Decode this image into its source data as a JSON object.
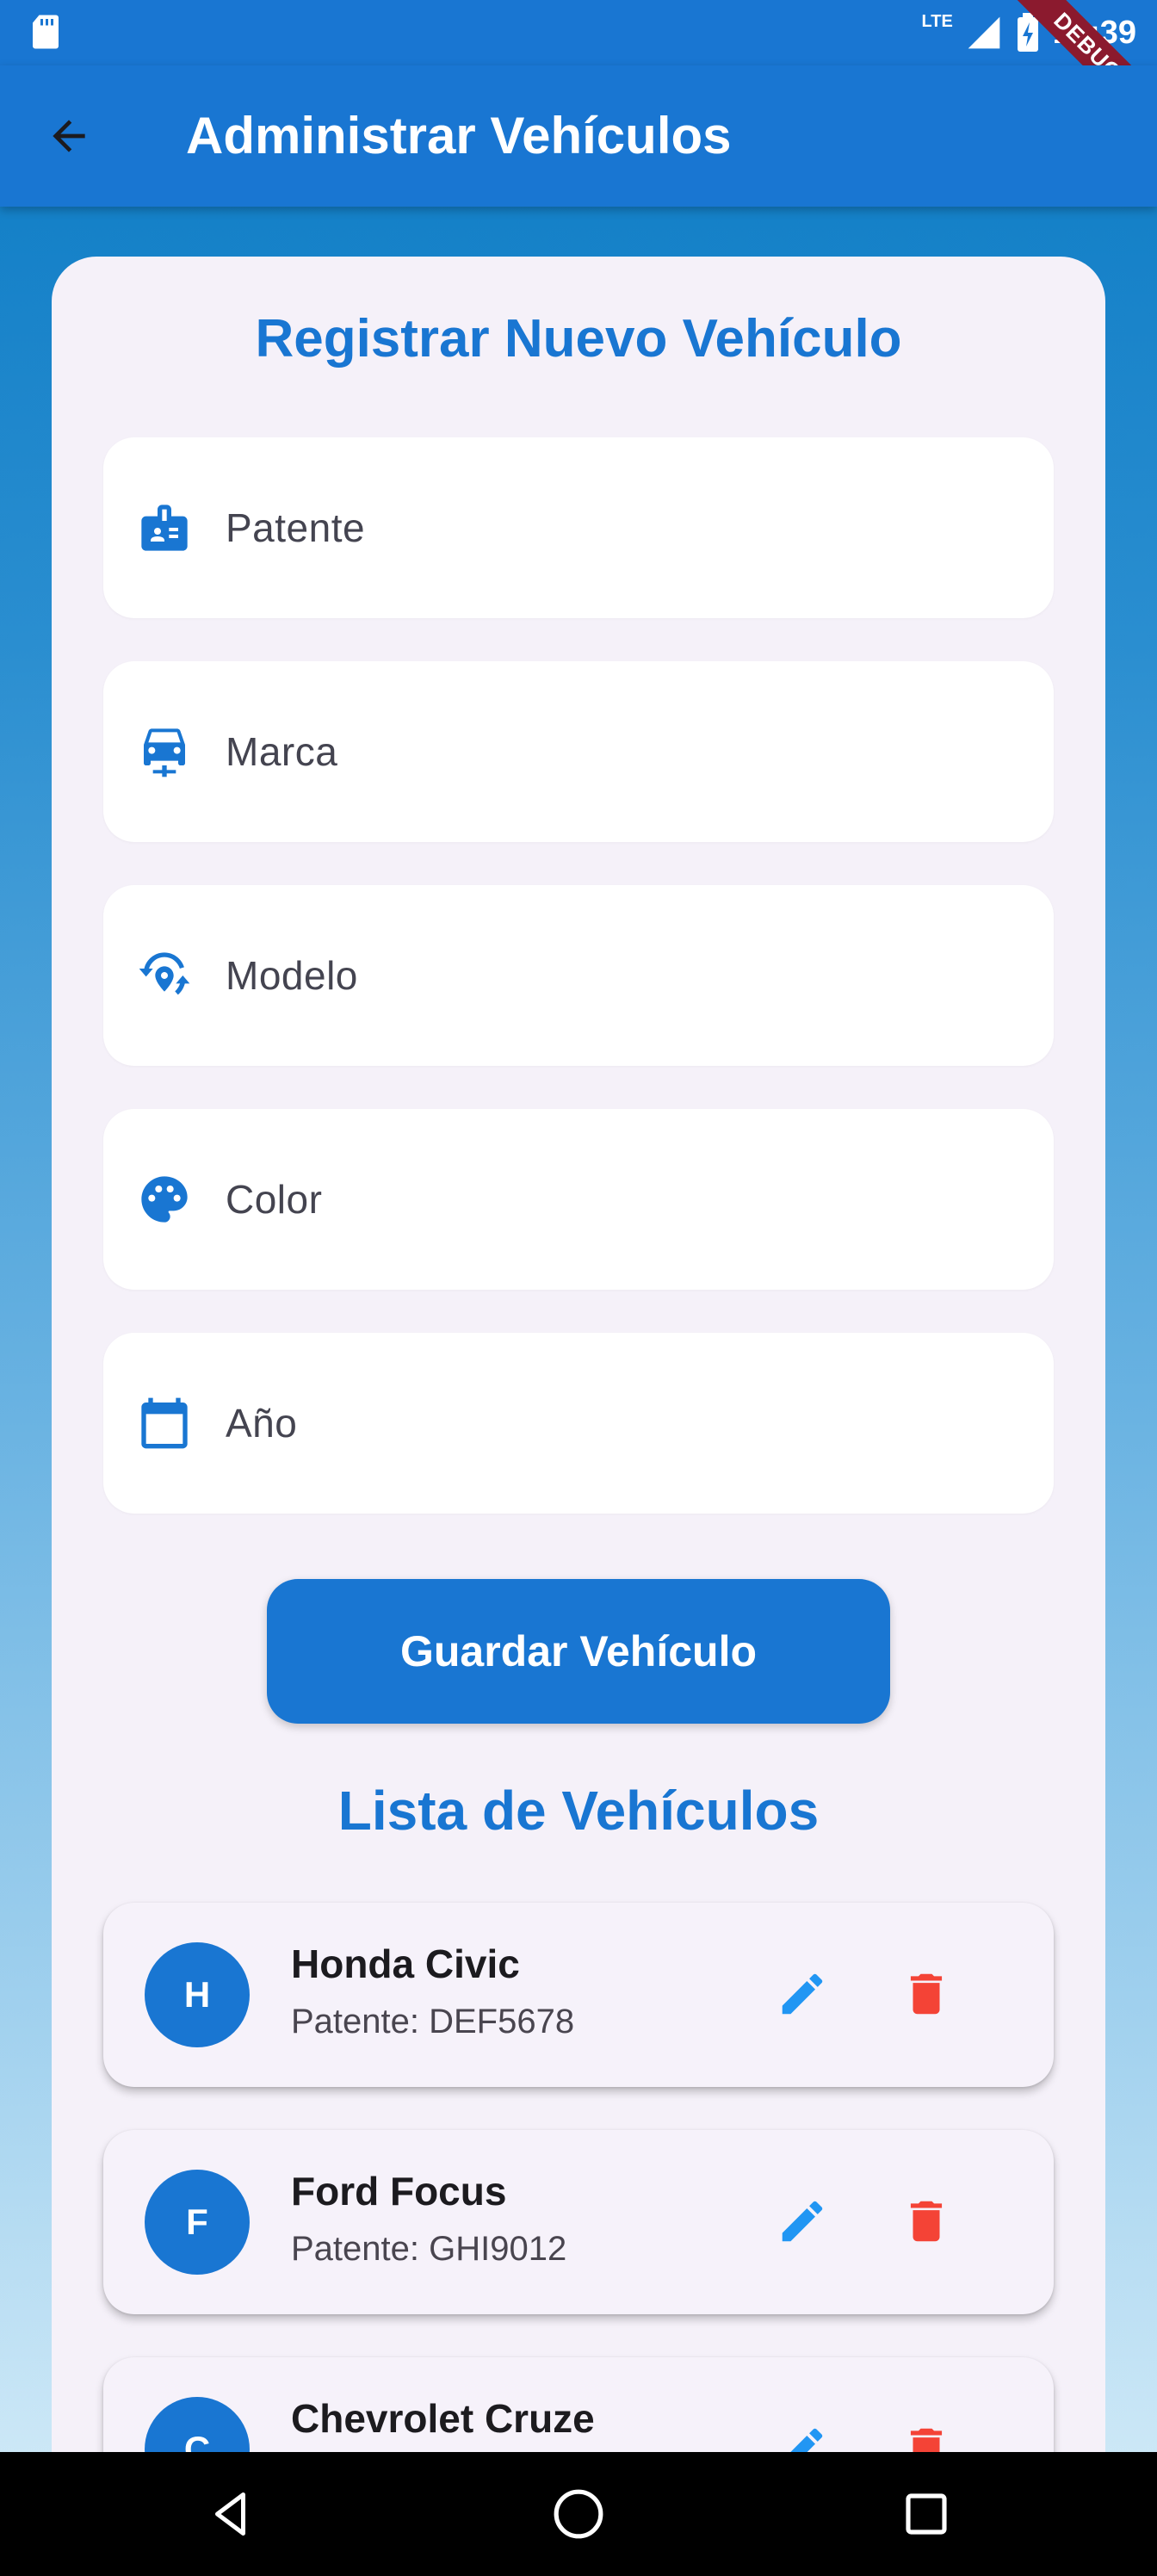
{
  "status_bar": {
    "time": "12:39",
    "network": "LTE",
    "debug_label": "DEBUG"
  },
  "app_bar": {
    "title": "Administrar Vehículos"
  },
  "form": {
    "title": "Registrar Nuevo Vehículo",
    "fields": [
      {
        "label": "Patente",
        "icon": "badge-icon"
      },
      {
        "label": "Marca",
        "icon": "car-icon"
      },
      {
        "label": "Modelo",
        "icon": "model-icon"
      },
      {
        "label": "Color",
        "icon": "palette-icon"
      },
      {
        "label": "Año",
        "icon": "calendar-icon"
      }
    ],
    "save_label": "Guardar Vehículo"
  },
  "list": {
    "title": "Lista de Vehículos",
    "vehicles": [
      {
        "initial": "H",
        "name": "Honda Civic",
        "plate": "Patente: DEF5678"
      },
      {
        "initial": "F",
        "name": "Ford Focus",
        "plate": "Patente: GHI9012"
      },
      {
        "initial": "C",
        "name": "Chevrolet Cruze",
        "plate": ""
      }
    ]
  },
  "colors": {
    "primary": "#1976d2",
    "delete": "#f44336",
    "edit": "#2196f3"
  }
}
